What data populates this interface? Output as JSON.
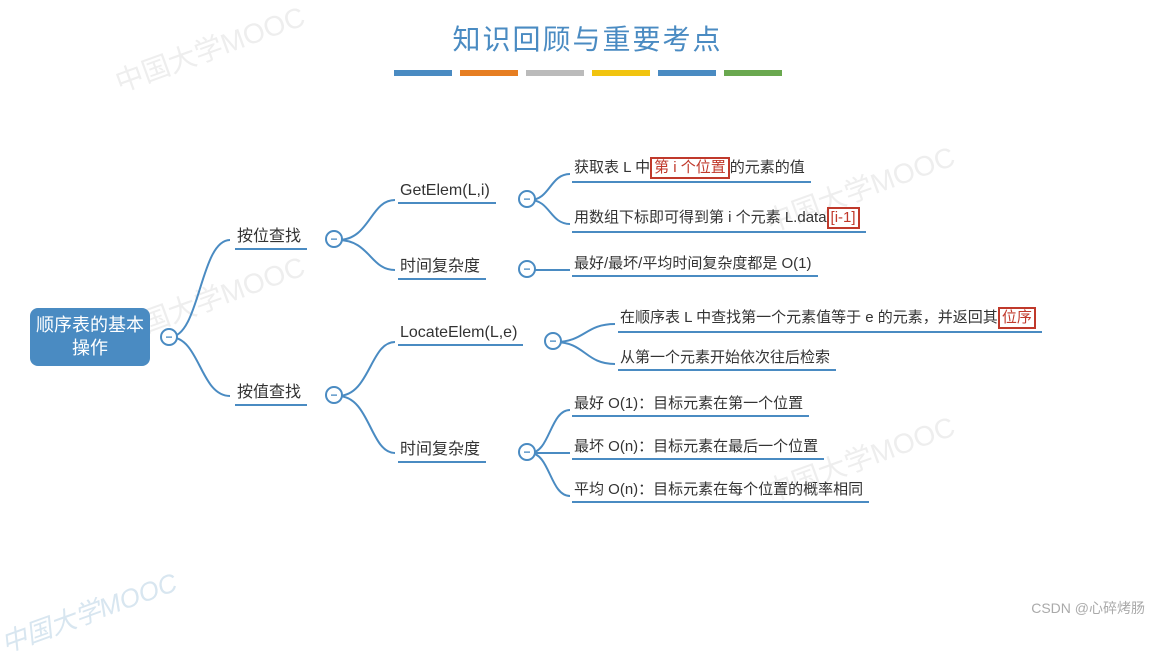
{
  "title": "知识回顾与重要考点",
  "root": "顺序表的基本操作",
  "level1": {
    "byPos": "按位查找",
    "byVal": "按值查找"
  },
  "byPos": {
    "getElem": "GetElem(L,i)",
    "time": "时间复杂度",
    "leaf1_a": "获取表 L 中",
    "leaf1_hl": "第 i 个位置",
    "leaf1_b": "的元素的值",
    "leaf2_a": "用数组下标即可得到第 i 个元素 L.data",
    "leaf2_hl": "[i-1]",
    "leaf3": "最好/最坏/平均时间复杂度都是 O(1)"
  },
  "byVal": {
    "locateElem": "LocateElem(L,e)",
    "time": "时间复杂度",
    "leaf1_a": "在顺序表 L 中查找第一个元素值等于 e 的元素，并返回其",
    "leaf1_hl": "位序",
    "leaf2": "从第一个元素开始依次往后检索",
    "leaf3": "最好 O(1)：目标元素在第一个位置",
    "leaf4": "最坏 O(n)：目标元素在最后一个位置",
    "leaf5": "平均 O(n)：目标元素在每个位置的概率相同"
  },
  "toggle_label": "−",
  "watermark": "中国大学MOOC",
  "csdn": "CSDN @心碎烤肠"
}
